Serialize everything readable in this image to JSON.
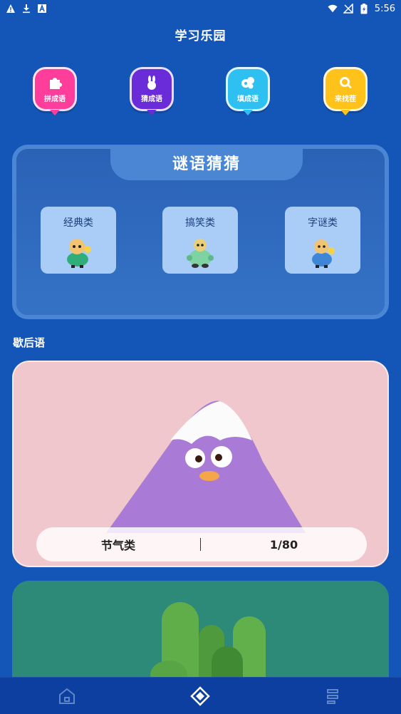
{
  "status_bar": {
    "time": "5:56",
    "left_icons": [
      "alert-icon",
      "download-icon",
      "app-a-icon"
    ],
    "right_icons": [
      "wifi-icon",
      "signal-off-icon",
      "battery-icon"
    ]
  },
  "app": {
    "title": "学习乐园"
  },
  "quick_actions": [
    {
      "label": "拼成语",
      "icon": "puzzle-icon",
      "color": "#ff3d9a"
    },
    {
      "label": "猜成语",
      "icon": "rabbit-icon",
      "color": "#6a2bd8"
    },
    {
      "label": "填成语",
      "icon": "bubbles-icon",
      "color": "#2ec0f0"
    },
    {
      "label": "来找茬",
      "icon": "search-icon",
      "color": "#ffc21a"
    }
  ],
  "riddle": {
    "title": "谜语猜猜",
    "categories": [
      {
        "label": "经典类"
      },
      {
        "label": "搞笑类"
      },
      {
        "label": "字谜类"
      }
    ]
  },
  "xiehouyu": {
    "section_title": "歇后语",
    "cards": [
      {
        "category": "节气类",
        "progress": "1/80",
        "bg": "#f0c7cd"
      },
      {
        "bg": "#2e8a78"
      }
    ]
  },
  "bottom_nav": {
    "items": [
      {
        "icon": "home-icon"
      },
      {
        "icon": "diamond-nav-icon",
        "active": true
      },
      {
        "icon": "profile-nav-icon"
      }
    ]
  }
}
